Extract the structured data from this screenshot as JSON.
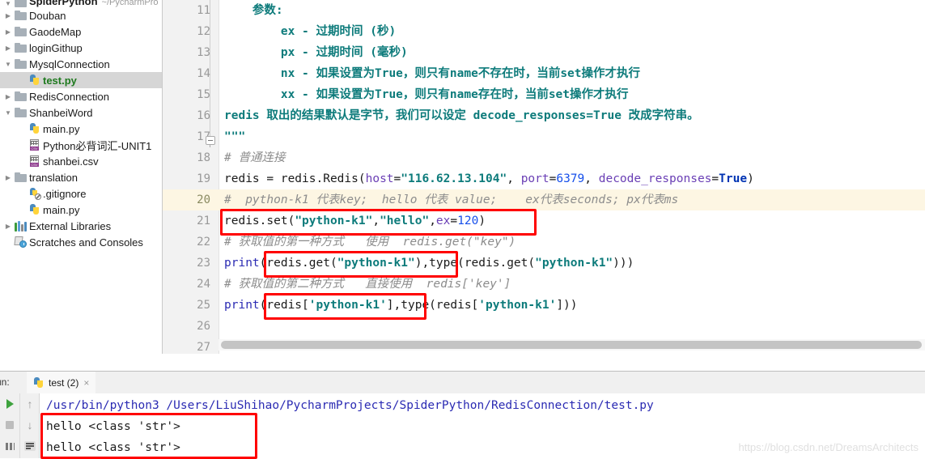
{
  "project_tree": {
    "root": {
      "label": "SpiderPython",
      "path_hint": "~/PycharmPro",
      "icon": "folder-icon"
    },
    "items": [
      {
        "label": "Douban",
        "icon": "folder-icon",
        "indent": 0,
        "twisty": "collapsed",
        "selected": false
      },
      {
        "label": "GaodeMap",
        "icon": "folder-icon",
        "indent": 0,
        "twisty": "collapsed",
        "selected": false
      },
      {
        "label": "loginGithup",
        "icon": "folder-icon",
        "indent": 0,
        "twisty": "collapsed",
        "selected": false
      },
      {
        "label": "MysqlConnection",
        "icon": "folder-icon",
        "indent": 0,
        "twisty": "expanded",
        "selected": false
      },
      {
        "label": "test.py",
        "icon": "python-file-icon",
        "indent": 1,
        "twisty": "none",
        "selected": true
      },
      {
        "label": "RedisConnection",
        "icon": "folder-icon",
        "indent": 0,
        "twisty": "collapsed",
        "selected": false
      },
      {
        "label": "ShanbeiWord",
        "icon": "folder-icon",
        "indent": 0,
        "twisty": "expanded",
        "selected": false
      },
      {
        "label": "main.py",
        "icon": "python-file-icon",
        "indent": 1,
        "twisty": "none",
        "selected": false
      },
      {
        "label": "Python必背词汇-UNIT1",
        "icon": "csv-file-icon",
        "indent": 1,
        "twisty": "none",
        "selected": false
      },
      {
        "label": "shanbei.csv",
        "icon": "csv-file-icon",
        "indent": 1,
        "twisty": "none",
        "selected": false
      },
      {
        "label": "translation",
        "icon": "folder-icon",
        "indent": 0,
        "twisty": "collapsed",
        "selected": false
      },
      {
        "label": ".gitignore",
        "icon": "gitignore-icon",
        "indent": 1,
        "twisty": "none",
        "selected": false
      },
      {
        "label": "main.py",
        "icon": "python-file-icon",
        "indent": 1,
        "twisty": "none",
        "selected": false
      },
      {
        "label": "External Libraries",
        "icon": "libraries-icon",
        "indent": 0,
        "twisty": "collapsed",
        "selected": false
      },
      {
        "label": "Scratches and Consoles",
        "icon": "scratches-icon",
        "indent": 0,
        "twisty": "none",
        "selected": false
      }
    ]
  },
  "editor": {
    "first_line_number": 11,
    "highlighted_line": 20,
    "lines": [
      {
        "n": 11,
        "tokens": [
          {
            "t": "    参数:",
            "c": "s-doc"
          }
        ]
      },
      {
        "n": 12,
        "tokens": [
          {
            "t": "        ex - 过期时间 (秒)",
            "c": "s-doc"
          }
        ]
      },
      {
        "n": 13,
        "tokens": [
          {
            "t": "        px - 过期时间 (毫秒)",
            "c": "s-doc"
          }
        ]
      },
      {
        "n": 14,
        "tokens": [
          {
            "t": "        nx - 如果设置为True，则只有name不存在时，当前set操作才执行",
            "c": "s-doc"
          }
        ]
      },
      {
        "n": 15,
        "tokens": [
          {
            "t": "        xx - 如果设置为True，则只有name存在时，当前set操作才执行",
            "c": "s-doc"
          }
        ]
      },
      {
        "n": 16,
        "tokens": [
          {
            "t": "redis 取出的结果默认是字节，我们可以设定 decode_responses=True 改成字符串。",
            "c": "s-doc"
          }
        ]
      },
      {
        "n": 17,
        "tokens": [
          {
            "t": "\"\"\"",
            "c": "s-doc"
          }
        ]
      },
      {
        "n": 18,
        "tokens": [
          {
            "t": "# 普通连接",
            "c": "s-cmt"
          }
        ]
      },
      {
        "n": 19,
        "tokens": [
          {
            "t": "redis = redis.Redis(",
            "c": "s-def"
          },
          {
            "t": "host",
            "c": "s-param"
          },
          {
            "t": "=",
            "c": "s-def"
          },
          {
            "t": "\"116.62.13.104\"",
            "c": "s-str"
          },
          {
            "t": ", ",
            "c": "s-def"
          },
          {
            "t": "port",
            "c": "s-param"
          },
          {
            "t": "=",
            "c": "s-def"
          },
          {
            "t": "6379",
            "c": "s-num"
          },
          {
            "t": ", ",
            "c": "s-def"
          },
          {
            "t": "decode_responses",
            "c": "s-param"
          },
          {
            "t": "=",
            "c": "s-def"
          },
          {
            "t": "True",
            "c": "s-kw"
          },
          {
            "t": ")",
            "c": "s-def"
          }
        ]
      },
      {
        "n": 20,
        "tokens": [
          {
            "t": "#  python-k1 代表key;  hello 代表 value;    ex代表seconds; px代表ms",
            "c": "s-cmt"
          }
        ]
      },
      {
        "n": 21,
        "tokens": [
          {
            "t": "redis.set(",
            "c": "s-def"
          },
          {
            "t": "\"python-k1\"",
            "c": "s-str"
          },
          {
            "t": ",",
            "c": "s-def"
          },
          {
            "t": "\"hello\"",
            "c": "s-str"
          },
          {
            "t": ",",
            "c": "s-def"
          },
          {
            "t": "ex",
            "c": "s-param"
          },
          {
            "t": "=",
            "c": "s-def"
          },
          {
            "t": "120",
            "c": "s-num"
          },
          {
            "t": ")",
            "c": "s-def"
          }
        ]
      },
      {
        "n": 22,
        "tokens": [
          {
            "t": "# 获取值的第一种方式   使用  redis.get(\"key\")",
            "c": "s-cmt"
          }
        ]
      },
      {
        "n": 23,
        "tokens": [
          {
            "t": "print",
            "c": "s-print"
          },
          {
            "t": "(redis.get(",
            "c": "s-def"
          },
          {
            "t": "\"python-k1\"",
            "c": "s-str"
          },
          {
            "t": "),type(redis.get(",
            "c": "s-def"
          },
          {
            "t": "\"python-k1\"",
            "c": "s-str"
          },
          {
            "t": ")))",
            "c": "s-def"
          }
        ]
      },
      {
        "n": 24,
        "tokens": [
          {
            "t": "# 获取值的第二种方式   直接使用  redis['key']",
            "c": "s-cmt"
          }
        ]
      },
      {
        "n": 25,
        "tokens": [
          {
            "t": "print",
            "c": "s-print"
          },
          {
            "t": "(redis[",
            "c": "s-def"
          },
          {
            "t": "'python-k1'",
            "c": "s-str"
          },
          {
            "t": "],type(redis[",
            "c": "s-def"
          },
          {
            "t": "'python-k1'",
            "c": "s-str"
          },
          {
            "t": "]))",
            "c": "s-def"
          }
        ]
      },
      {
        "n": 26,
        "tokens": [
          {
            "t": "",
            "c": "s-def"
          }
        ]
      },
      {
        "n": 27,
        "tokens": [
          {
            "t": "",
            "c": "s-def"
          }
        ]
      }
    ]
  },
  "run_panel": {
    "label": "un:",
    "tab": {
      "title": "test (2)",
      "icon": "python-icon",
      "close": "×"
    },
    "toolbar": [
      {
        "name": "rerun-button",
        "icon": "play-icon"
      },
      {
        "name": "stop-button",
        "icon": "stop-icon"
      },
      {
        "name": "print-button",
        "icon": "grid-icon"
      },
      {
        "name": "scroll-up-button",
        "icon": "arrow-up-icon",
        "glyph": "↑"
      },
      {
        "name": "scroll-down-button",
        "icon": "arrow-down-icon",
        "glyph": "↓"
      },
      {
        "name": "soft-wrap-button",
        "icon": "wrap-icon"
      }
    ],
    "console": {
      "command": "/usr/bin/python3 /Users/LiuShihao/PycharmProjects/SpiderPython/RedisConnection/test.py",
      "output": [
        "hello <class 'str'>",
        "hello <class 'str'>"
      ]
    }
  },
  "watermark": "https://blog.csdn.net/DreamsArchitects",
  "colors": {
    "annotation_red": "#ff0000",
    "highlight_line": "#fdf6e3",
    "selection_gray": "#d6d6d6",
    "string_teal": "#0d7b7b",
    "keyword_blue": "#0033b3",
    "number_blue": "#1750eb",
    "param_purple": "#6a3fb5",
    "comment_gray": "#8c8c8c"
  }
}
